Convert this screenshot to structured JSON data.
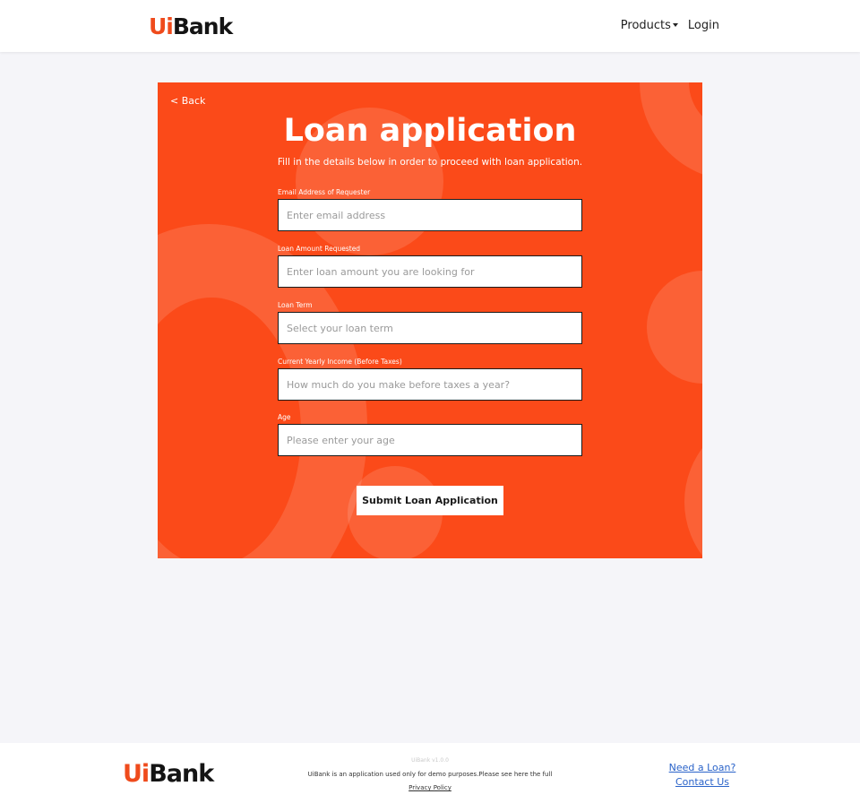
{
  "header": {
    "logo_ui": "Ui",
    "logo_bank": "Bank",
    "nav": {
      "products": "Products",
      "login": "Login"
    }
  },
  "card": {
    "back": "< Back",
    "title": "Loan application",
    "subtitle": "Fill in the details below in order to proceed with loan application.",
    "fields": [
      {
        "label": "Email Address of Requester",
        "placeholder": "Enter email address"
      },
      {
        "label": "Loan Amount Requested",
        "placeholder": "Enter loan amount you are looking for"
      },
      {
        "label": "Loan Term",
        "placeholder": "Select your loan term"
      },
      {
        "label": "Current Yearly Income (Before Taxes)",
        "placeholder": "How much do you make before taxes a year?"
      },
      {
        "label": "Age",
        "placeholder": "Please enter your age"
      }
    ],
    "submit": "Submit Loan Application"
  },
  "footer": {
    "logo_ui": "Ui",
    "logo_bank": "Bank",
    "version": "UiBank v1.0.0",
    "disclaimer": "UiBank is an application used only for demo purposes.Please see here the full",
    "privacy_link": "Privacy Policy",
    "links": {
      "need_loan": "Need a Loan?",
      "contact": "Contact Us"
    }
  },
  "colors": {
    "accent": "#fb4a19",
    "logo_accent": "#ef4b1c",
    "link": "#2a63c9"
  }
}
